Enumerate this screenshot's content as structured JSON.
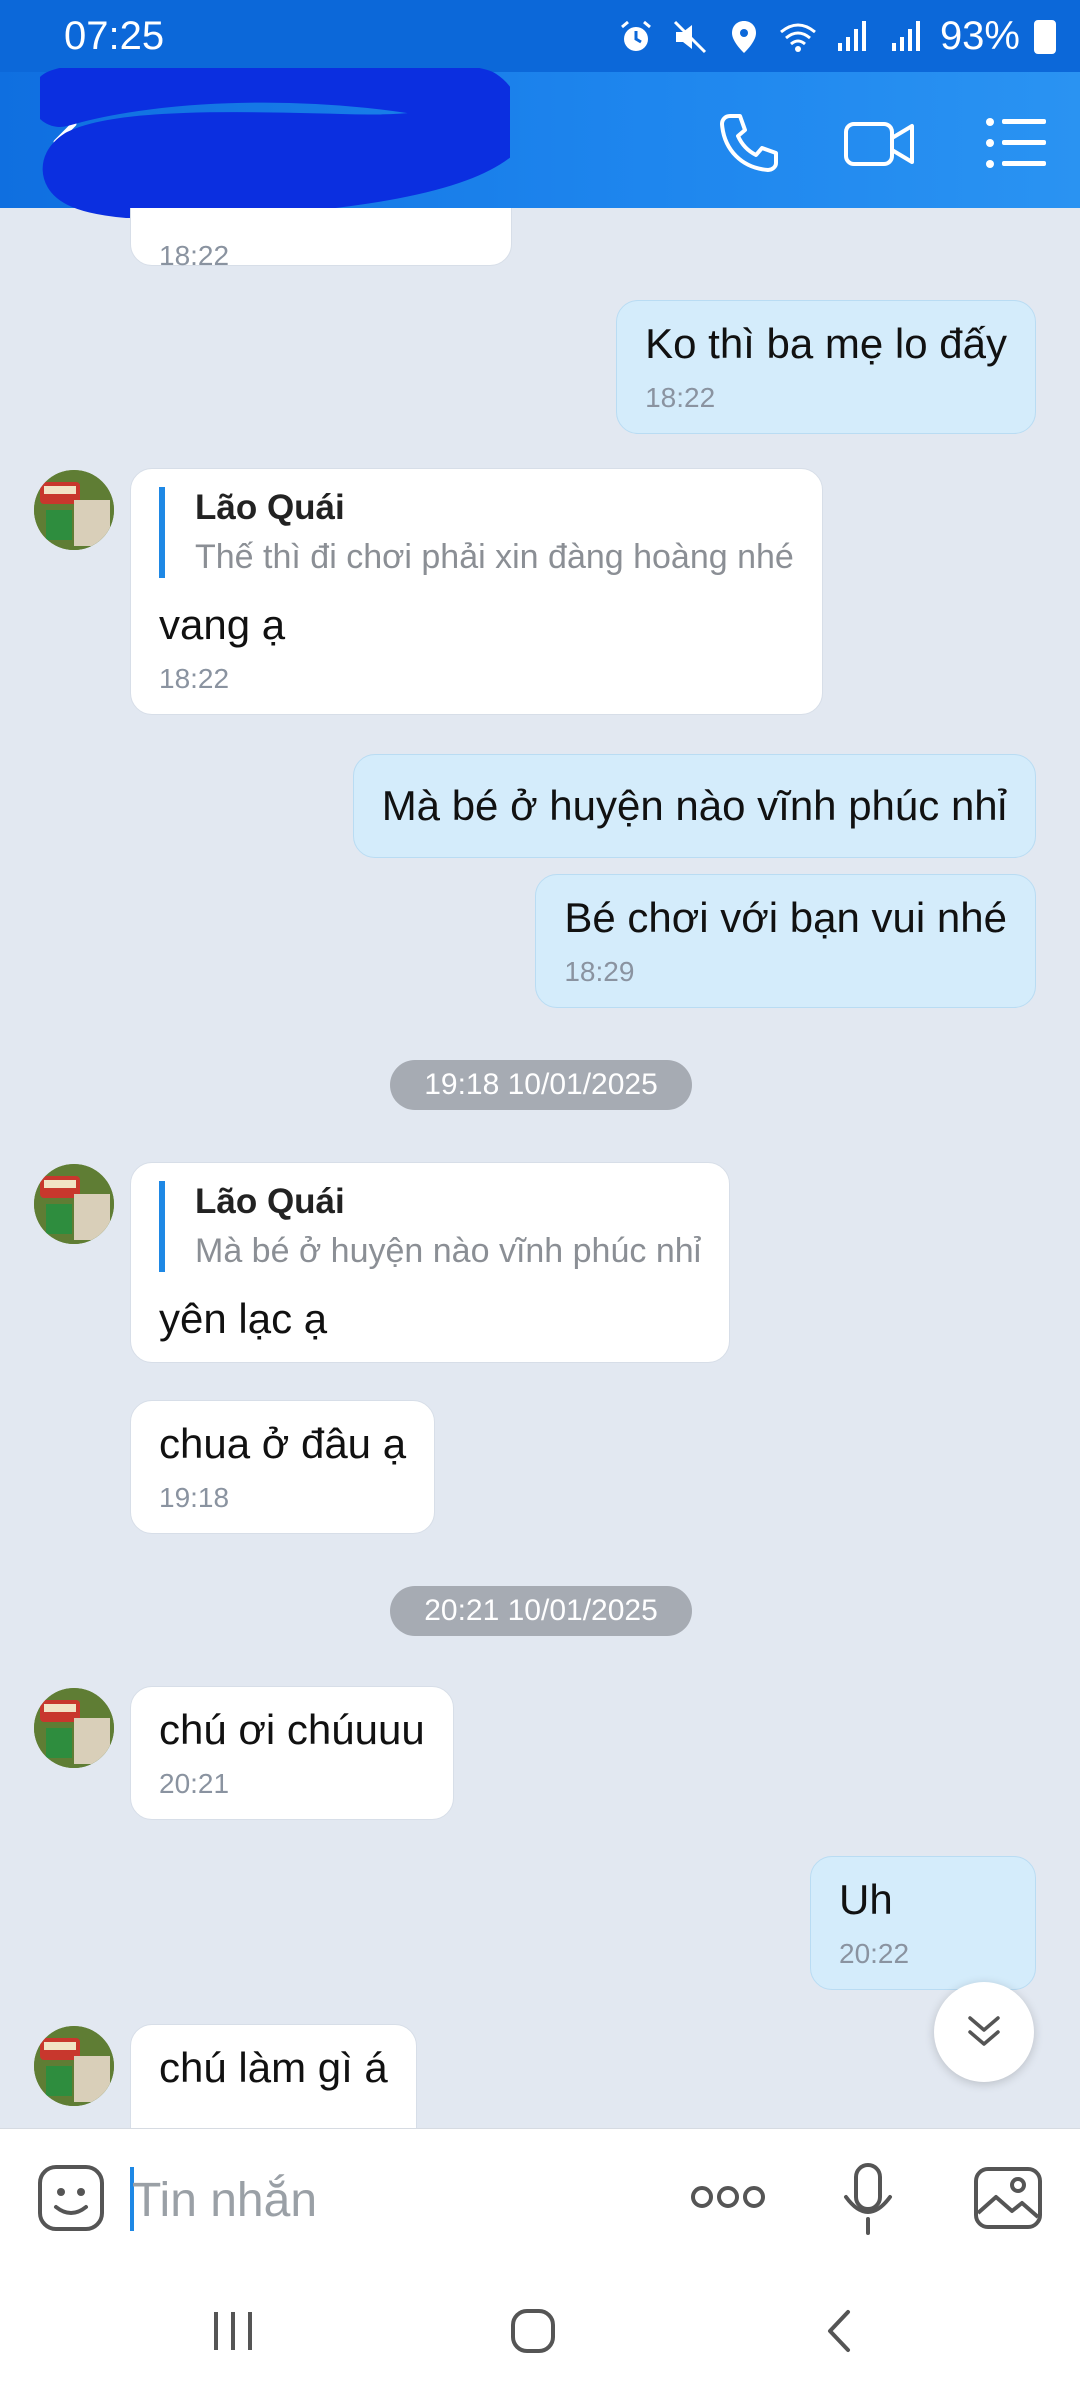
{
  "status_bar": {
    "time": "07:25",
    "battery": "93%",
    "icons": [
      "alarm-icon",
      "mute-icon",
      "location-icon",
      "wifi-icon",
      "signal-icon",
      "signal-icon",
      "battery-icon"
    ]
  },
  "header": {
    "title": "",
    "actions": [
      "phone-icon",
      "video-call-icon",
      "menu-icon"
    ]
  },
  "messages": [
    {
      "id": "m0",
      "side": "in",
      "time": "18:22"
    },
    {
      "id": "m1",
      "side": "out",
      "text": "Ko thì ba mẹ lo đấy",
      "time": "18:22"
    },
    {
      "id": "m2",
      "side": "in",
      "quote_name": "Lão Quái",
      "quote_text": "Thế thì đi chơi phải xin đàng hoàng nhé",
      "text": "vang ạ",
      "time": "18:22"
    },
    {
      "id": "m3",
      "side": "out",
      "text": "Mà bé ở huyện nào vĩnh phúc nhỉ"
    },
    {
      "id": "m4",
      "side": "out",
      "text": "Bé chơi với bạn vui nhé",
      "time": "18:29"
    },
    {
      "id": "d1",
      "type": "date",
      "text": "19:18 10/01/2025"
    },
    {
      "id": "m5",
      "side": "in",
      "quote_name": "Lão Quái",
      "quote_text": "Mà bé ở huyện nào vĩnh phúc nhỉ",
      "text": "yên lạc ạ"
    },
    {
      "id": "m6",
      "side": "in",
      "text": "chua ở đâu ạ",
      "time": "19:18"
    },
    {
      "id": "d2",
      "type": "date",
      "text": "20:21 10/01/2025"
    },
    {
      "id": "m7",
      "side": "in",
      "text": "chú ơi chúuuu",
      "time": "20:21"
    },
    {
      "id": "m8",
      "side": "out",
      "text": "Uh",
      "time": "20:22"
    },
    {
      "id": "m9",
      "side": "in",
      "text": "chú làm gì á"
    }
  ],
  "composer": {
    "placeholder": "Tin nhắn",
    "value": ""
  },
  "colors": {
    "header": "#1e86ee",
    "status_bar": "#0c68d9",
    "chat_bg": "#e2e8f1",
    "outgoing_bubble": "#d4ecfb",
    "incoming_bubble": "#ffffff",
    "accent": "#1e88e5"
  }
}
